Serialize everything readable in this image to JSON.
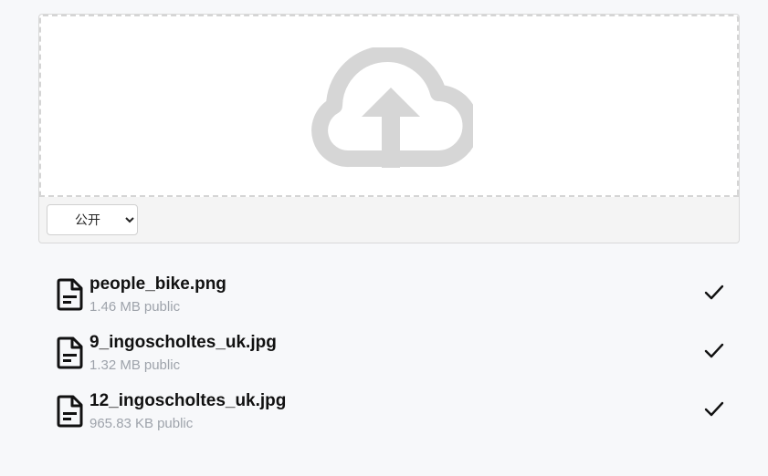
{
  "uploader": {
    "dropzone_icon": "cloud-upload-icon",
    "visibility": {
      "selected": "公开",
      "options": [
        "公开"
      ]
    }
  },
  "files": [
    {
      "name": "people_bike.png",
      "size": "1.46 MB",
      "visibility": "public",
      "status": "check-icon"
    },
    {
      "name": "9_ingoscholtes_uk.jpg",
      "size": "1.32 MB",
      "visibility": "public",
      "status": "check-icon"
    },
    {
      "name": "12_ingoscholtes_uk.jpg",
      "size": "965.83 KB",
      "visibility": "public",
      "status": "check-icon"
    }
  ],
  "colors": {
    "icon_gray": "#d6d6d6",
    "meta_text": "#9ea3ab",
    "background": "#f7f8fa"
  }
}
